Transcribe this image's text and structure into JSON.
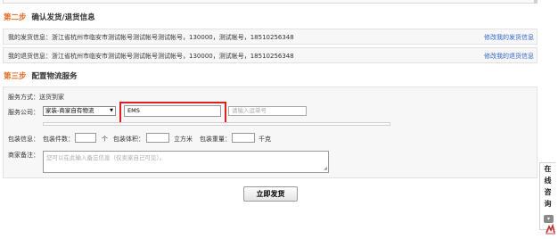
{
  "step2": {
    "number": "第二步",
    "title": "确认发货/退货信息",
    "ship_address": {
      "text": "我的发货信息：浙江省杭州市临安市测试帐号测试帐号测试帐号，130000，测试帐号，18510256348",
      "link": "修改我的发货信息"
    },
    "return_address": {
      "text": "我的退货信息：浙江省杭州市临安市测试帐号测试帐号测试帐号，130000，测试帐号，18510256348",
      "link": "修改我的退货信息"
    }
  },
  "step3": {
    "number": "第三步",
    "title": "配置物流服务",
    "service_label": "服务方式：送货到家",
    "company_label": "服务公司：",
    "company_select": "家装-商家自有物流",
    "company_input": "EMS",
    "tracking_placeholder": "请输入运单号",
    "package_label": "包装信息：",
    "count_label": "包装件数：",
    "count_unit": "个",
    "volume_label": "包装体积：",
    "volume_unit": "立方米",
    "weight_label": "包装重量：",
    "weight_unit": "千克",
    "remark_label": "商家备注：",
    "remark_placeholder": "您可以在此输入备忘信息（仅卖家自己可见）。"
  },
  "submit_label": "立即发货",
  "consult": {
    "chars": [
      "在",
      "线",
      "咨",
      "询"
    ],
    "expand": "▾"
  }
}
